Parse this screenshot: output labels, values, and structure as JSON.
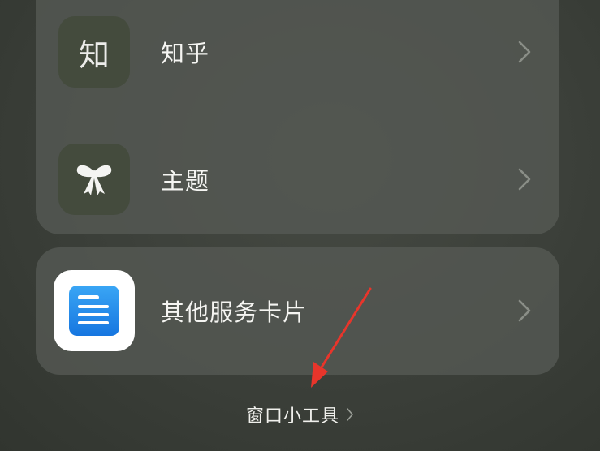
{
  "list": {
    "items": [
      {
        "label": "知乎",
        "icon_text": "知",
        "icon": "zhihu-icon"
      },
      {
        "label": "主题",
        "icon": "bow-icon"
      }
    ]
  },
  "services": {
    "label": "其他服务卡片",
    "icon": "service-card-icon"
  },
  "footer": {
    "label": "窗口小工具"
  },
  "colors": {
    "background": "#3d413b",
    "card": "#565a54",
    "icon_tile": "#444b3d",
    "service_icon": "#1e88e5",
    "arrow": "#e8352b"
  }
}
